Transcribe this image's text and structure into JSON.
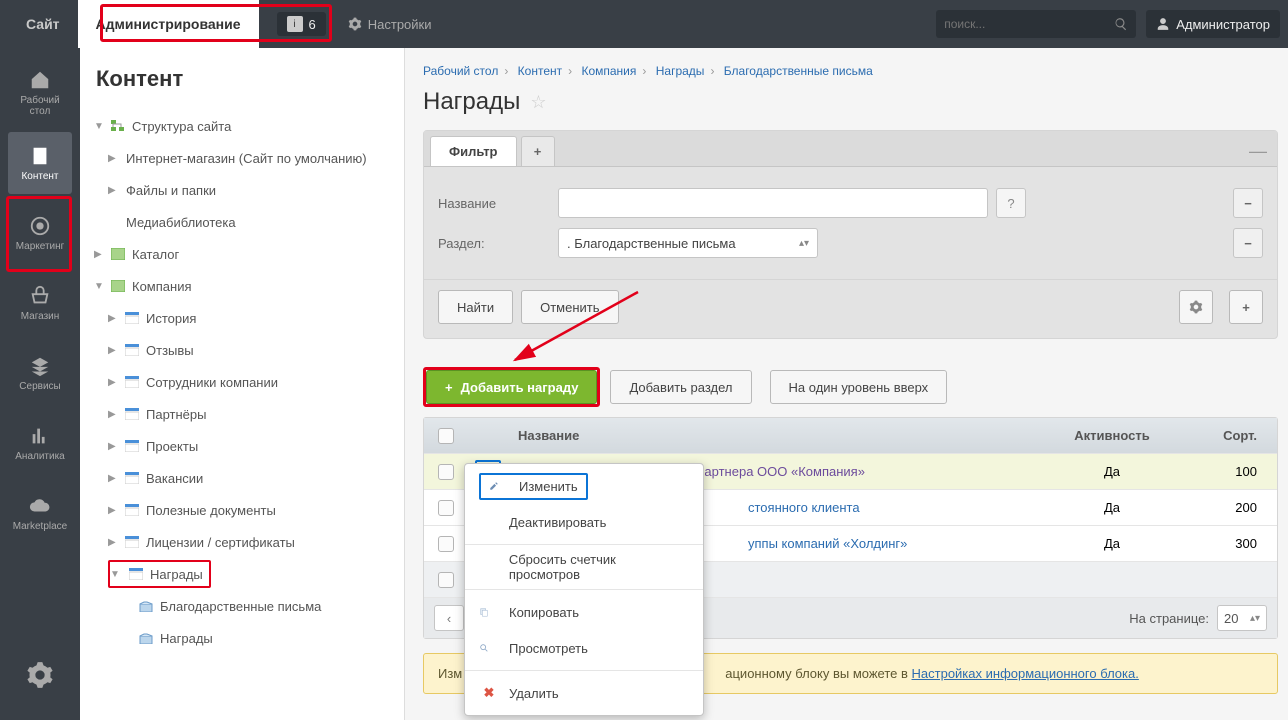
{
  "topbar": {
    "site": "Сайт",
    "admin": "Администрирование",
    "notif_count": "6",
    "settings": "Настройки",
    "search_placeholder": "поиск...",
    "user": "Администратор"
  },
  "leftrail": [
    {
      "label": "Рабочий\nстол"
    },
    {
      "label": "Контент"
    },
    {
      "label": "Маркетинг"
    },
    {
      "label": "Магазин"
    },
    {
      "label": "Сервисы"
    },
    {
      "label": "Аналитика"
    },
    {
      "label": "Marketplace"
    }
  ],
  "sidebar": {
    "title": "Контент",
    "nodes": {
      "struct": "Структура сайта",
      "shop": "Интернет-магазин (Сайт по умолчанию)",
      "files": "Файлы и папки",
      "media": "Медиабиблиотека",
      "catalog": "Каталог",
      "company": "Компания",
      "history": "История",
      "reviews": "Отзывы",
      "staff": "Сотрудники компании",
      "partners": "Партнёры",
      "projects": "Проекты",
      "vacancies": "Вакансии",
      "docs": "Полезные документы",
      "licenses": "Лицензии / сертификаты",
      "awards": "Награды",
      "letters": "Благодарственные письма",
      "awards2": "Награды"
    }
  },
  "breadcrumb": {
    "i0": "Рабочий стол",
    "i1": "Контент",
    "i2": "Компания",
    "i3": "Награды",
    "i4": "Благодарственные письма"
  },
  "page_title": "Награды",
  "filter": {
    "tab": "Фильтр",
    "name_label": "Название",
    "section_label": "Раздел:",
    "section_value": ". Благодарственные письма",
    "find": "Найти",
    "cancel": "Отменить"
  },
  "actions": {
    "add": "Добавить награду",
    "add_section": "Добавить раздел",
    "up": "На один уровень вверх"
  },
  "table": {
    "col_name": "Название",
    "col_active": "Активность",
    "col_sort": "Сорт.",
    "rows": [
      {
        "name": "Благодарственное письмо от партнера ООО «Компания»",
        "active": "Да",
        "sort": "100"
      },
      {
        "name": "стоянного клиента",
        "active": "Да",
        "sort": "200"
      },
      {
        "name": "уппы компаний «Холдинг»",
        "active": "Да",
        "sort": "300"
      }
    ],
    "per_page_label": "На странице:",
    "per_page_val": "20"
  },
  "infobar": {
    "prefix": "Изм",
    "middle": "ационному блоку вы можете в ",
    "link": "Настройках информационного блока."
  },
  "ctx": {
    "edit": "Изменить",
    "deact": "Деактивировать",
    "reset": "Сбросить счетчик просмотров",
    "copy": "Копировать",
    "view": "Просмотреть",
    "del": "Удалить"
  }
}
